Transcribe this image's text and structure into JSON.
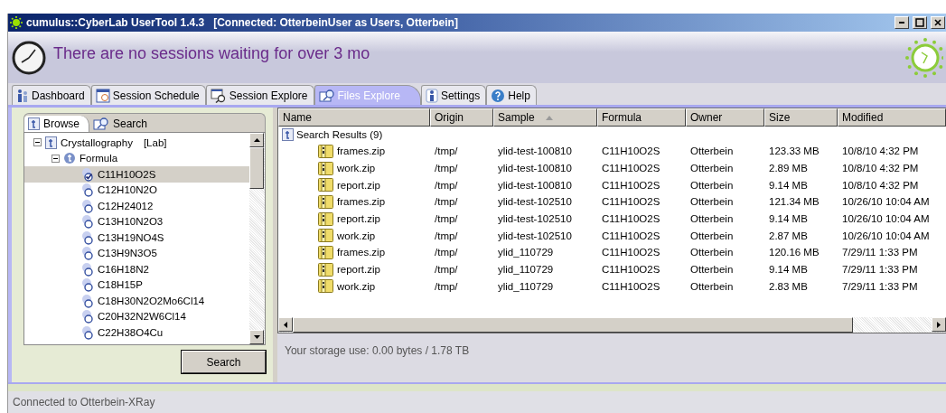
{
  "window": {
    "title": "cumulus::CyberLab UserTool 1.4.3   [Connected: OtterbeinUser as Users, Otterbein]"
  },
  "banner": {
    "message": "There are no sessions waiting for over 3 mo"
  },
  "tabs": [
    {
      "label": "Dashboard",
      "selected": false
    },
    {
      "label": "Session Schedule",
      "selected": false
    },
    {
      "label": "Session Explore",
      "selected": false
    },
    {
      "label": "Files Explore",
      "selected": true
    },
    {
      "label": "Settings",
      "selected": false
    },
    {
      "label": "Help",
      "selected": false
    }
  ],
  "browser": {
    "tabs": [
      {
        "label": "Browse",
        "selected": true
      },
      {
        "label": "Search",
        "selected": false
      }
    ],
    "tree": {
      "label": "Crystallography",
      "tag": "[Lab]",
      "expanded": true,
      "children": [
        {
          "label": "Formula",
          "expanded": true,
          "children": [
            {
              "label": "C11H10O2S",
              "selected": true
            },
            {
              "label": "C12H10N2O",
              "selected": false
            },
            {
              "label": "C12H24012",
              "selected": false
            },
            {
              "label": "C13H10N2O3",
              "selected": false
            },
            {
              "label": "C13H19NO4S",
              "selected": false
            },
            {
              "label": "C13H9N3O5",
              "selected": false
            },
            {
              "label": "C16H18N2",
              "selected": false
            },
            {
              "label": "C18H15P",
              "selected": false
            },
            {
              "label": "C18H30N2O2Mo6Cl14",
              "selected": false
            },
            {
              "label": "C20H32N2W6Cl14",
              "selected": false
            },
            {
              "label": "C22H38O4Cu",
              "selected": false
            }
          ]
        }
      ]
    },
    "search_button": "Search"
  },
  "results": {
    "columns": [
      {
        "label": "Name",
        "sorted": false
      },
      {
        "label": "Origin",
        "sorted": false
      },
      {
        "label": "Sample",
        "sorted": true
      },
      {
        "label": "Formula",
        "sorted": false
      },
      {
        "label": "Owner",
        "sorted": false
      },
      {
        "label": "Size",
        "sorted": false
      },
      {
        "label": "Modified",
        "sorted": false
      }
    ],
    "group": "Search Results (9)",
    "rows": [
      {
        "name": "frames.zip",
        "origin": "/tmp/",
        "sample": "ylid-test-100810",
        "formula": "C11H10O2S",
        "owner": "Otterbein",
        "size": "123.33 MB",
        "modified": "10/8/10 4:32 PM"
      },
      {
        "name": "work.zip",
        "origin": "/tmp/",
        "sample": "ylid-test-100810",
        "formula": "C11H10O2S",
        "owner": "Otterbein",
        "size": "2.89 MB",
        "modified": "10/8/10 4:32 PM"
      },
      {
        "name": "report.zip",
        "origin": "/tmp/",
        "sample": "ylid-test-100810",
        "formula": "C11H10O2S",
        "owner": "Otterbein",
        "size": "9.14 MB",
        "modified": "10/8/10 4:32 PM"
      },
      {
        "name": "frames.zip",
        "origin": "/tmp/",
        "sample": "ylid-test-102510",
        "formula": "C11H10O2S",
        "owner": "Otterbein",
        "size": "121.34 MB",
        "modified": "10/26/10 10:04 AM"
      },
      {
        "name": "report.zip",
        "origin": "/tmp/",
        "sample": "ylid-test-102510",
        "formula": "C11H10O2S",
        "owner": "Otterbein",
        "size": "9.14 MB",
        "modified": "10/26/10 10:04 AM"
      },
      {
        "name": "work.zip",
        "origin": "/tmp/",
        "sample": "ylid-test-102510",
        "formula": "C11H10O2S",
        "owner": "Otterbein",
        "size": "2.87 MB",
        "modified": "10/26/10 10:04 AM"
      },
      {
        "name": "frames.zip",
        "origin": "/tmp/",
        "sample": "ylid_110729",
        "formula": "C11H10O2S",
        "owner": "Otterbein",
        "size": "120.16 MB",
        "modified": "7/29/11 1:33 PM"
      },
      {
        "name": "report.zip",
        "origin": "/tmp/",
        "sample": "ylid_110729",
        "formula": "C11H10O2S",
        "owner": "Otterbein",
        "size": "9.14 MB",
        "modified": "7/29/11 1:33 PM"
      },
      {
        "name": "work.zip",
        "origin": "/tmp/",
        "sample": "ylid_110729",
        "formula": "C11H10O2S",
        "owner": "Otterbein",
        "size": "2.83 MB",
        "modified": "7/29/11 1:33 PM"
      }
    ],
    "storage": "Your storage use: 0.00 bytes / 1.78 TB"
  },
  "status_bar": "Connected to Otterbein-XRay"
}
